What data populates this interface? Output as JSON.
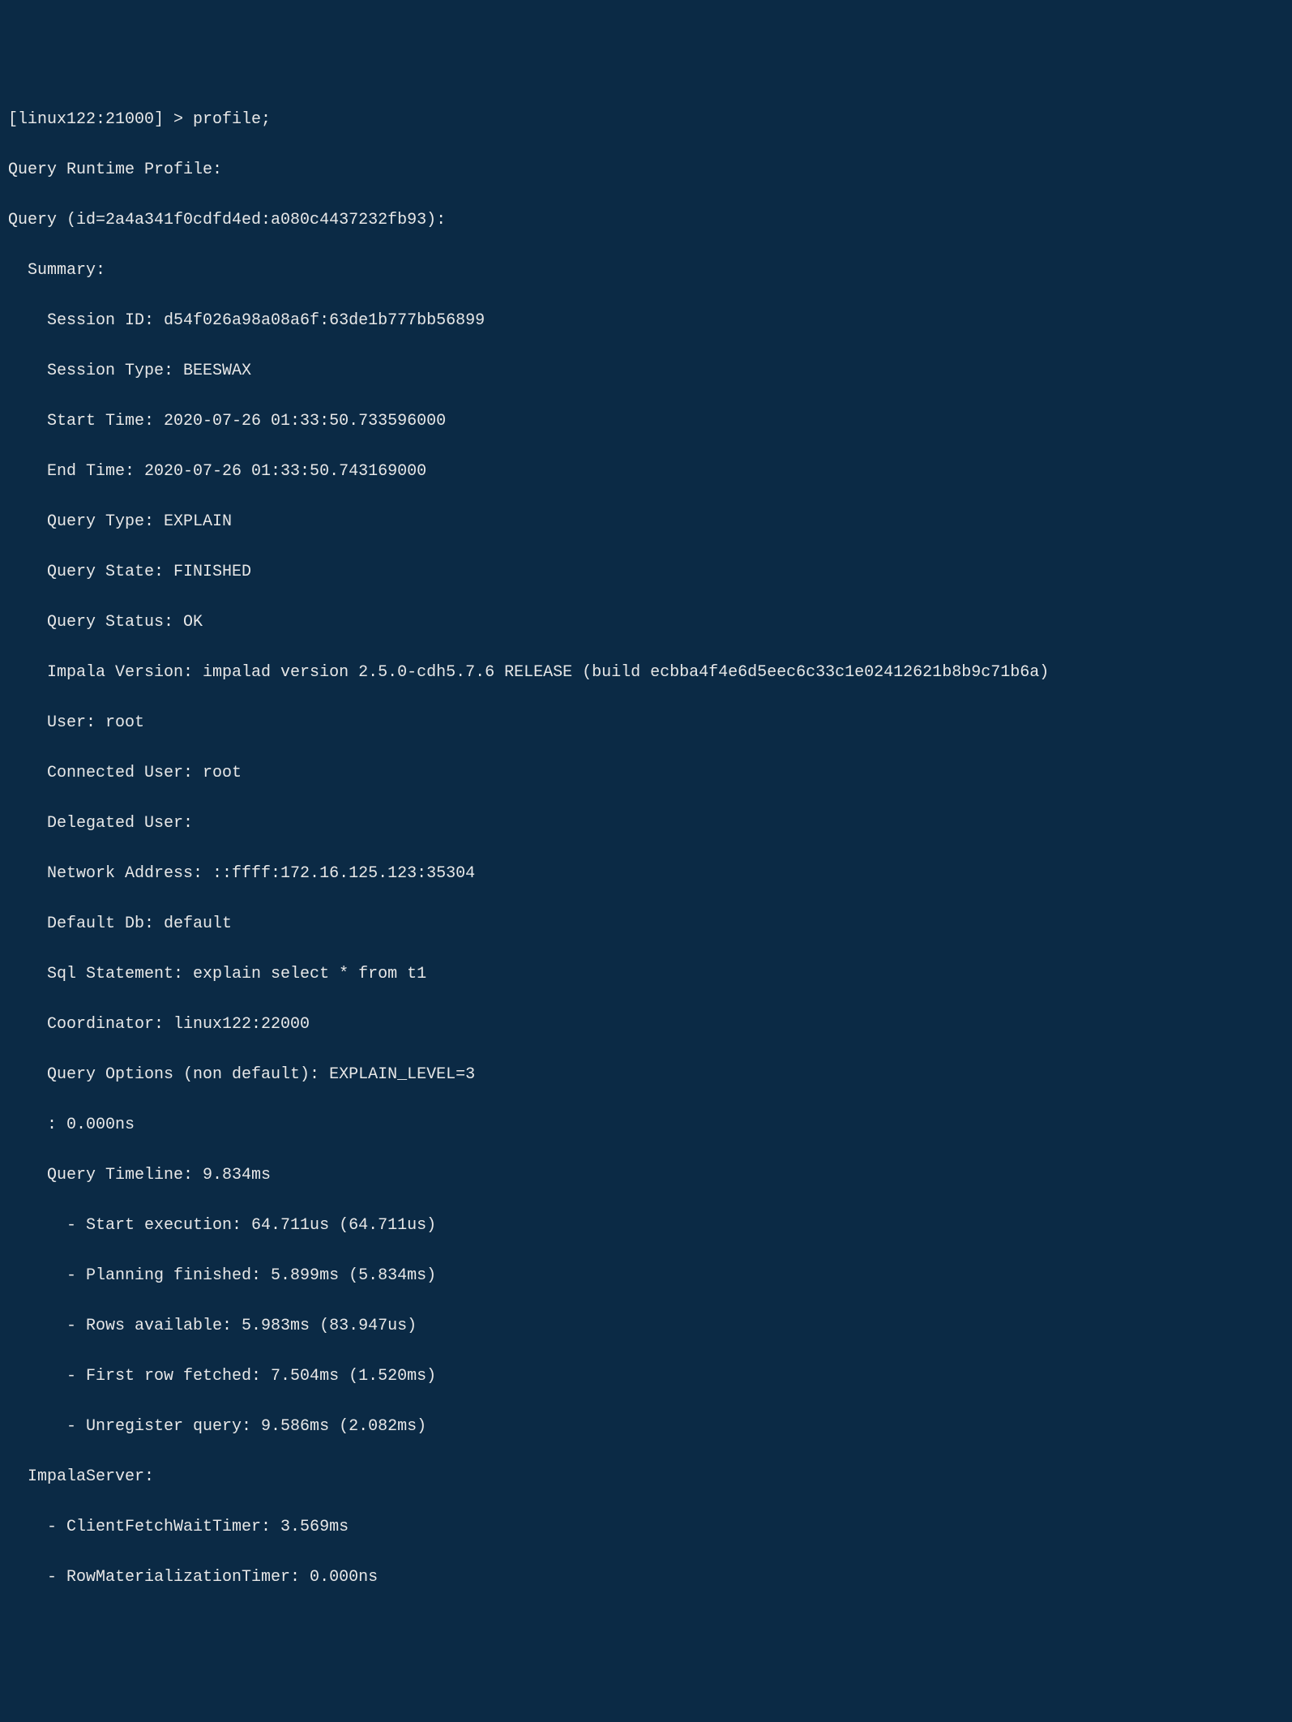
{
  "prompt": "[linux122:21000] > profile;",
  "header1": "Query Runtime Profile:",
  "header2": "Query (id=2a4a341f0cdfd4ed:a080c4437232fb93):",
  "summary_label": "  Summary:",
  "summary": {
    "session_id": "    Session ID: d54f026a98a08a6f:63de1b777bb56899",
    "session_type": "    Session Type: BEESWAX",
    "start_time": "    Start Time: 2020-07-26 01:33:50.733596000",
    "end_time": "    End Time: 2020-07-26 01:33:50.743169000",
    "query_type": "    Query Type: EXPLAIN",
    "query_state": "    Query State: FINISHED",
    "query_status": "    Query Status: OK",
    "impala_version": "    Impala Version: impalad version 2.5.0-cdh5.7.6 RELEASE (build ecbba4f4e6d5eec6c33c1e02412621b8b9c71b6a)",
    "user": "    User: root",
    "connected_user": "    Connected User: root",
    "delegated_user": "    Delegated User: ",
    "network_address": "    Network Address: ::ffff:172.16.125.123:35304",
    "default_db": "    Default Db: default",
    "sql_statement": "    Sql Statement: explain select * from t1",
    "coordinator": "    Coordinator: linux122:22000",
    "query_options": "    Query Options (non default): EXPLAIN_LEVEL=3",
    "zero_ns": "    : 0.000ns",
    "query_timeline": "    Query Timeline: 9.834ms"
  },
  "timeline": {
    "t0": "      - Start execution: 64.711us (64.711us)",
    "t1": "      - Planning finished: 5.899ms (5.834ms)",
    "t2": "      - Rows available: 5.983ms (83.947us)",
    "t3": "      - First row fetched: 7.504ms (1.520ms)",
    "t4": "      - Unregister query: 9.586ms (2.082ms)"
  },
  "impala_server_label": "  ImpalaServer:",
  "impala_server": {
    "m0": "    - ClientFetchWaitTimer: 3.569ms",
    "m1": "    - RowMaterializationTimer: 0.000ns"
  }
}
